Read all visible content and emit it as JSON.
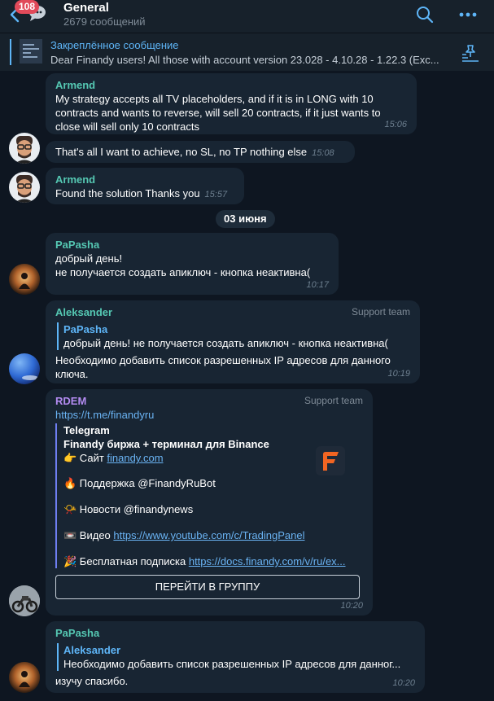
{
  "header": {
    "badge": "108",
    "title": "General",
    "subtitle": "2679 сообщений"
  },
  "pinned": {
    "title": "Закреплённое сообщение",
    "text": "Dear Finandy users!  All those with account version 23.028 - 4.10.28 - 1.22.3 (Exc..."
  },
  "date_separator": "03 июня",
  "messages": [
    {
      "author": "Armend",
      "lines": [
        "My strategy accepts all TV placeholders, and if it is in LONG with 10",
        "contracts and wants to reverse, will  sell 20 contracts, if it just wants to",
        "close will sell only 10 contracts"
      ],
      "time": "15:06"
    },
    {
      "text": "That's all I want to achieve, no SL, no TP nothing else",
      "time": "15:08"
    },
    {
      "author": "Armend",
      "text": "Found the solution Thanks you",
      "time": "15:57"
    },
    {
      "author": "PaPasha",
      "lines": [
        "добрый день!",
        "не получается создать апиключ - кнопка неактивна("
      ],
      "time": "10:17"
    },
    {
      "author": "Aleksander",
      "tag": "Support team",
      "quote_author": "PaPasha",
      "quote_text": "добрый день! не получается создать апиключ - кнопка неактивна(",
      "lines": [
        "Необходимо добавить список разрешенных IP адресов для данного",
        "ключа."
      ],
      "time": "10:19"
    },
    {
      "author": "RDEM",
      "tag": "Support team",
      "link": "https://t.me/finandyru",
      "preview_site": "Telegram",
      "preview_title": "Finandy биржа + терминал для Binance",
      "site_label": "👉 Сайт ",
      "site_link": "finandy.com",
      "support": "🔥 Поддержка @FinandyRuBot",
      "news": "📯 Новости @finandynews",
      "video_label": "📼 Видео ",
      "video_link": "https://www.youtube.com/c/TradingPanel",
      "sub_label": "🎉 Бесплатная подписка ",
      "sub_link": "https://docs.finandy.com/v/ru/ex...",
      "button": "ПЕРЕЙТИ В ГРУППУ",
      "time": "10:20"
    },
    {
      "author": "PaPasha",
      "quote_author": "Aleksander",
      "quote_text": "Необходимо добавить список разрешенных IP адресов для данног...",
      "text": "изучу спасибо.",
      "time": "10:20"
    }
  ],
  "colors": {
    "background": "#0e1621",
    "bubble": "#182533",
    "accent": "#5eb5f7",
    "name_armend": "#55c8b3",
    "name_papasha": "#55c8b3",
    "name_aleksander": "#55c8b3",
    "name_rdem": "#b48cf2",
    "badge": "#e14a5a"
  },
  "icons": [
    "back-arrow-icon",
    "chat-bubble-icon",
    "search-icon",
    "more-dots-icon",
    "pin-list-icon",
    "finandy-logo-icon"
  ]
}
